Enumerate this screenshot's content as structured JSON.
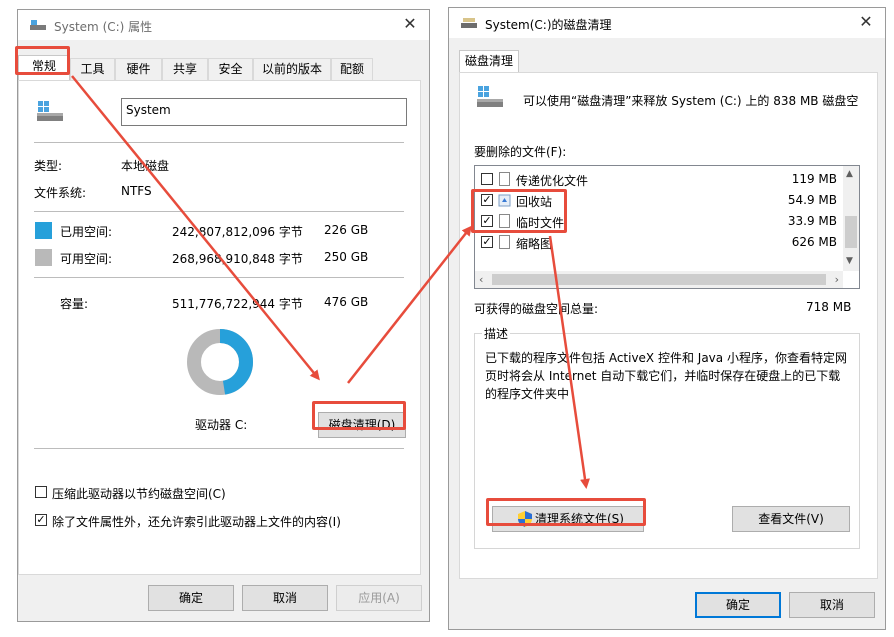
{
  "left_window": {
    "title": "System (C:) 属性",
    "tabs": [
      "常规",
      "工具",
      "硬件",
      "共享",
      "安全",
      "以前的版本",
      "配额"
    ],
    "drive_name": "System",
    "type_label": "类型:",
    "type_value": "本地磁盘",
    "fs_label": "文件系统:",
    "fs_value": "NTFS",
    "used_label": "已用空间:",
    "used_bytes": "242,807,812,096 字节",
    "used_size": "226 GB",
    "free_label": "可用空间:",
    "free_bytes": "268,968,910,848 字节",
    "free_size": "250 GB",
    "capacity_label": "容量:",
    "capacity_bytes": "511,776,722,944 字节",
    "capacity_size": "476 GB",
    "drive_label": "驱动器 C:",
    "cleanup_button": "磁盘清理(D)",
    "compress_label": "压缩此驱动器以节约磁盘空间(C)",
    "index_label": "除了文件属性外，还允许索引此驱动器上文件的内容(I)",
    "compress_checked": false,
    "index_checked": true,
    "ok": "确定",
    "cancel": "取消",
    "apply": "应用(A)",
    "used_color": "#26a0da",
    "free_color": "#b9b9b9",
    "used_fraction": 0.4744
  },
  "right_window": {
    "title": "System(C:)的磁盘清理",
    "tab": "磁盘清理",
    "intro": "可以使用“磁盘清理”来释放 System (C:) 上的 838 MB 磁盘空",
    "files_label": "要删除的文件(F):",
    "files": [
      {
        "name": "传递优化文件",
        "size": "119 MB",
        "checked": false
      },
      {
        "name": "回收站",
        "size": "54.9 MB",
        "checked": true
      },
      {
        "name": "临时文件",
        "size": "33.9 MB",
        "checked": true
      },
      {
        "name": "缩略图",
        "size": "626 MB",
        "checked": true
      }
    ],
    "total_label": "可获得的磁盘空间总量:",
    "total_value": "718 MB",
    "desc_title": "描述",
    "desc_line1": "已下载的程序文件包括 ActiveX 控件和 Java 小程序，你查看特定网",
    "desc_line2": "页时将会从 Internet 自动下载它们，并临时保存在硬盘上的已下载",
    "desc_line3": "的程序文件夹中",
    "clean_system_button": "清理系统文件(S)",
    "view_files_button": "查看文件(V)",
    "ok": "确定",
    "cancel": "取消"
  },
  "annotation_color": "#e74c3c"
}
